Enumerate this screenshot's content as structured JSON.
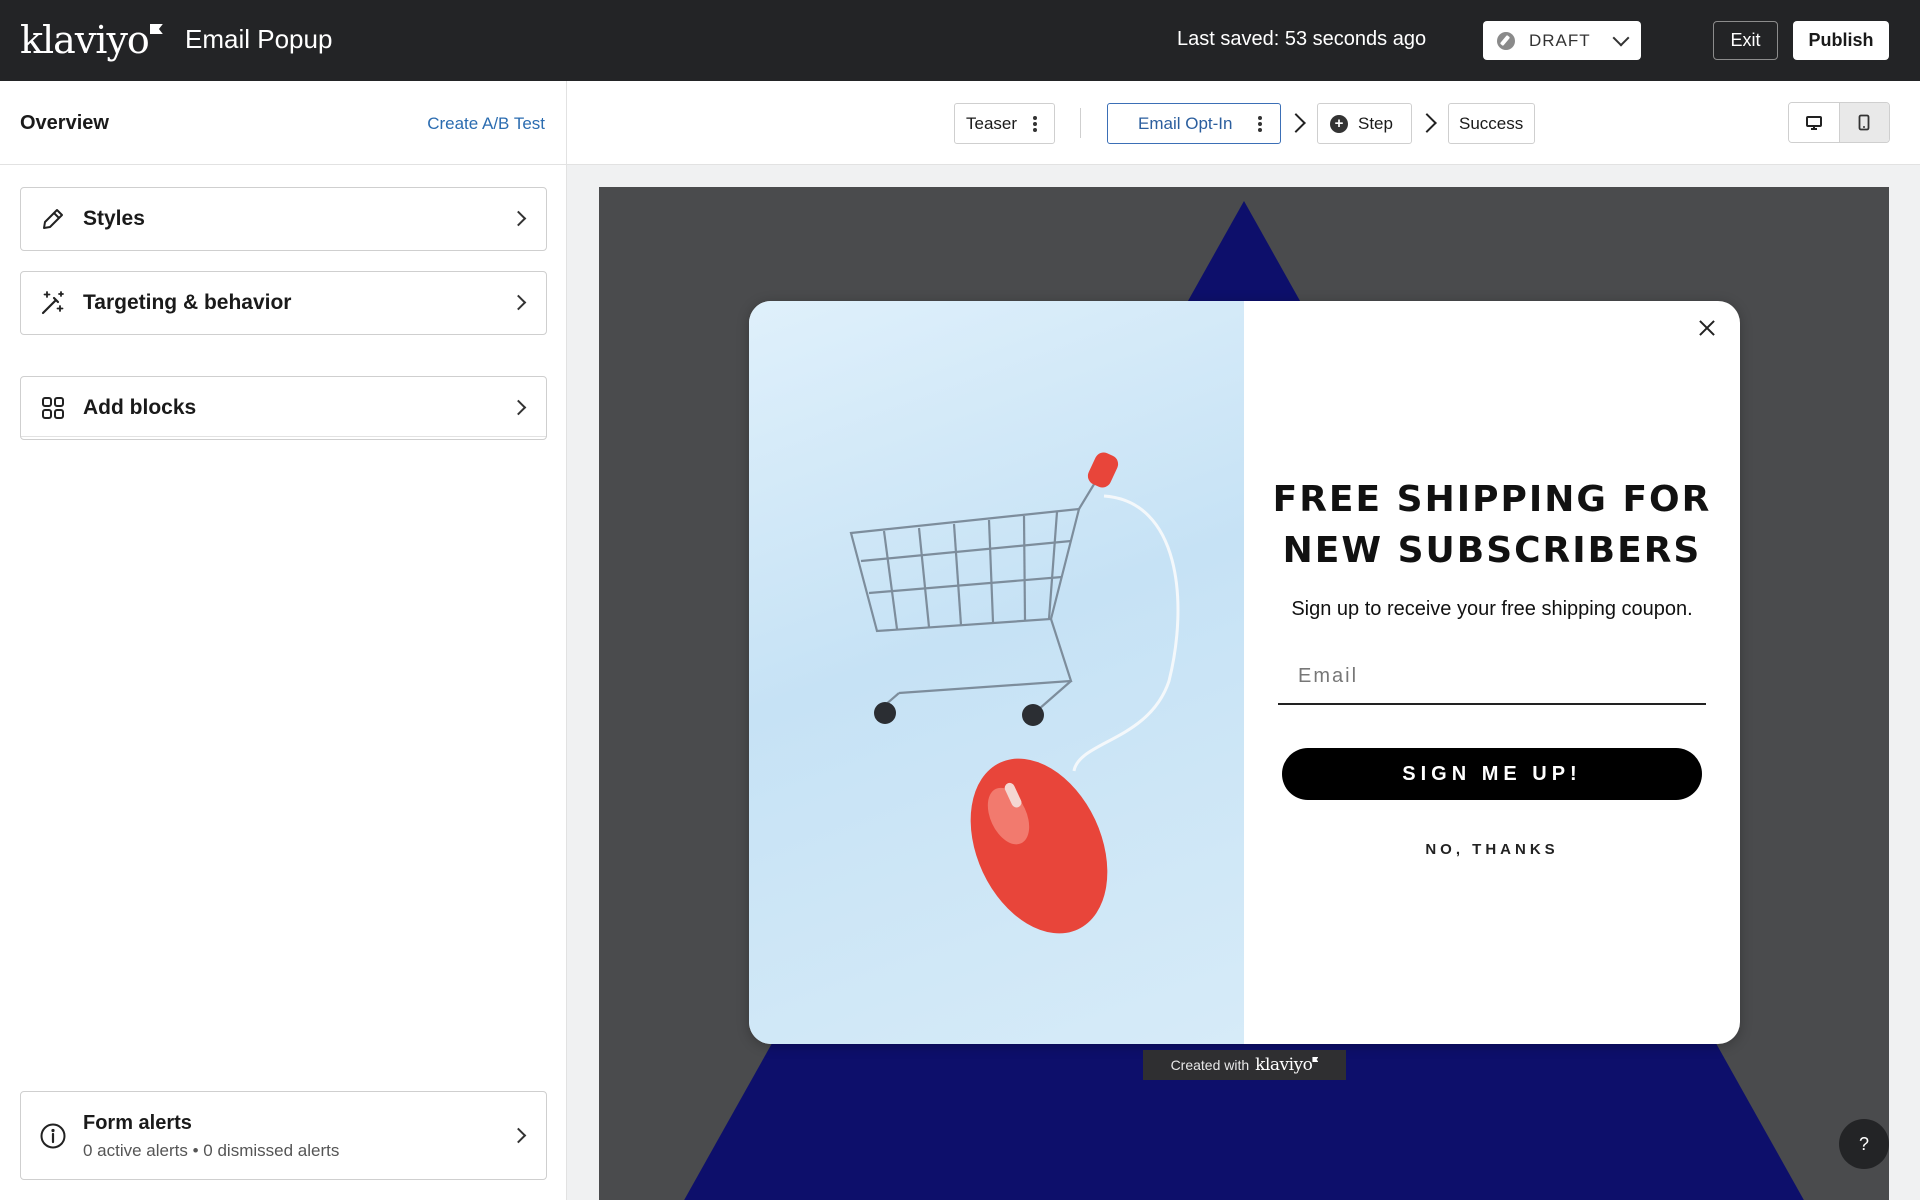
{
  "header": {
    "logo_text": "klaviyo",
    "title": "Email Popup",
    "last_saved": "Last saved: 53 seconds ago",
    "status_select": "DRAFT",
    "exit_label": "Exit",
    "publish_label": "Publish"
  },
  "sidebar": {
    "overview_label": "Overview",
    "create_ab_label": "Create A/B Test",
    "items": [
      {
        "label": "Styles",
        "icon": "pencil-icon"
      },
      {
        "label": "Targeting & behavior",
        "icon": "magic-wand-icon"
      },
      {
        "label": "Add blocks",
        "icon": "grid-icon"
      }
    ],
    "alerts": {
      "title": "Form alerts",
      "subtitle": "0 active alerts • 0 dismissed alerts",
      "icon": "info-icon"
    }
  },
  "steps": {
    "teaser": "Teaser",
    "email_optin": "Email Opt-In",
    "add_step": "Step",
    "success": "Success",
    "active": "Email Opt-In"
  },
  "device_toggle": {
    "desktop_icon": "desktop-icon",
    "mobile_icon": "mobile-icon",
    "selected": "desktop"
  },
  "popup": {
    "headline": "FREE SHIPPING FOR NEW SUBSCRIBERS",
    "subline": "Sign up to receive your free shipping coupon.",
    "email_placeholder": "Email",
    "signup_label": "SIGN ME UP!",
    "no_thanks_label": "NO, THANKS",
    "image_description_icon": "shopping-cart-mouse-image"
  },
  "footer": {
    "created_with": "Created with",
    "created_logo": "klaviyo",
    "help_label": "?"
  },
  "colors": {
    "topbar": "#232426",
    "canvas_bg": "#4a4b4d",
    "triangle": "#0d0f6b",
    "accent_link": "#2b6cb0"
  }
}
